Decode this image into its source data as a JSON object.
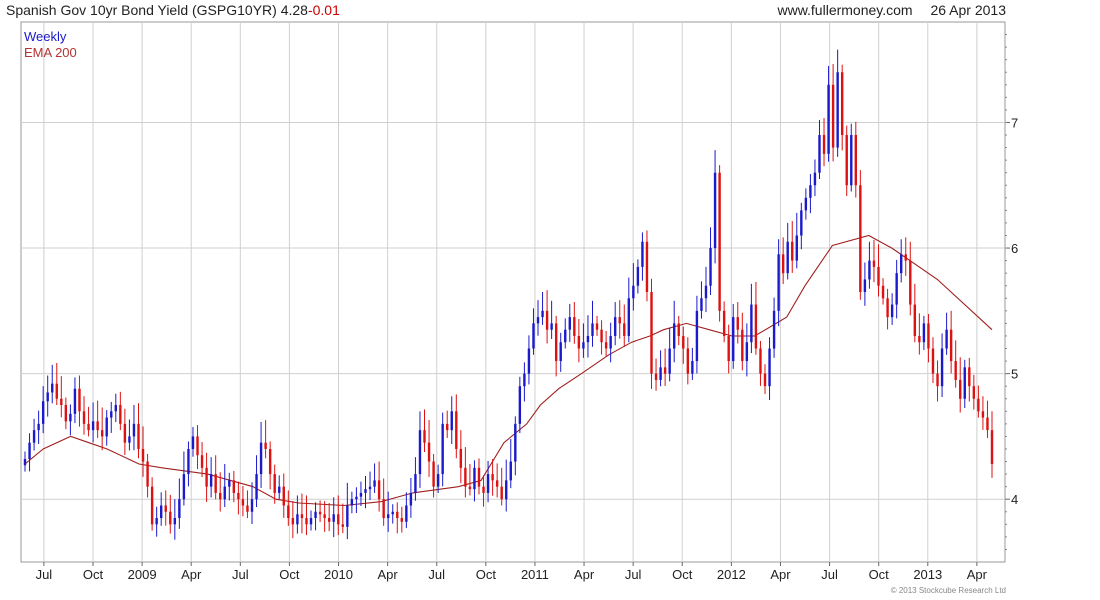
{
  "header": {
    "title": "Spanish Gov 10yr Bond Yield (GSPG10YR)",
    "last": "4.28",
    "change": "-0.01",
    "site": "www.fullermoney.com",
    "date": "26 Apr 2013"
  },
  "legend": {
    "line1": "Weekly",
    "line2": "EMA 200"
  },
  "footer": {
    "copyright": "© 2013 Stockcube Research Ltd"
  },
  "colors": {
    "up": "#1a1acc",
    "down": "#dd1111",
    "ema": "#a02020",
    "grid": "#d0d0d0"
  },
  "chart_data": {
    "type": "candlestick",
    "frequency": "weekly",
    "ylim": [
      3.5,
      7.8
    ],
    "y_ticks": [
      4,
      5,
      6,
      7
    ],
    "grid": true,
    "x_axis_ticks": [
      "Jul",
      "Oct",
      "2009",
      "Apr",
      "Jul",
      "Oct",
      "2010",
      "Apr",
      "Jul",
      "Oct",
      "2011",
      "Apr",
      "Jul",
      "Oct",
      "2012",
      "Apr",
      "Jul",
      "Oct",
      "2013",
      "Apr"
    ],
    "series": [
      {
        "name": "Weekly",
        "kind": "close",
        "values": [
          4.32,
          4.45,
          4.55,
          4.6,
          4.78,
          4.85,
          4.92,
          4.8,
          4.75,
          4.62,
          4.68,
          4.88,
          4.7,
          4.6,
          4.55,
          4.62,
          4.55,
          4.5,
          4.65,
          4.7,
          4.75,
          4.6,
          4.45,
          4.5,
          4.6,
          4.4,
          4.3,
          4.1,
          3.8,
          3.85,
          3.95,
          3.9,
          3.8,
          3.85,
          4.0,
          4.2,
          4.4,
          4.5,
          4.35,
          4.25,
          4.1,
          4.2,
          4.05,
          4.0,
          4.1,
          4.15,
          4.05,
          4.0,
          3.95,
          3.9,
          4.0,
          4.2,
          4.45,
          4.4,
          4.2,
          4.05,
          4.1,
          3.95,
          3.85,
          3.8,
          3.88,
          3.85,
          3.8,
          3.85,
          3.9,
          3.88,
          3.85,
          3.82,
          3.88,
          3.8,
          3.78,
          3.95,
          4.0,
          4.02,
          4.05,
          4.08,
          4.1,
          4.15,
          4.0,
          3.85,
          3.88,
          3.9,
          3.85,
          3.82,
          3.95,
          4.05,
          4.2,
          4.55,
          4.45,
          4.3,
          4.1,
          4.2,
          4.6,
          4.55,
          4.7,
          4.4,
          4.25,
          4.1,
          4.08,
          4.25,
          4.1,
          4.05,
          4.2,
          4.15,
          4.1,
          4.0,
          4.15,
          4.3,
          4.6,
          4.9,
          5.0,
          5.2,
          5.4,
          5.45,
          5.5,
          5.35,
          5.4,
          5.1,
          5.25,
          5.35,
          5.45,
          5.3,
          5.2,
          5.25,
          5.3,
          5.4,
          5.35,
          5.25,
          5.2,
          5.3,
          5.45,
          5.4,
          5.3,
          5.6,
          5.7,
          5.85,
          6.05,
          5.65,
          5.0,
          4.95,
          5.05,
          5.0,
          5.2,
          5.4,
          5.3,
          5.2,
          5.0,
          5.1,
          5.5,
          5.6,
          5.7,
          6.0,
          6.6,
          5.5,
          5.3,
          5.1,
          5.45,
          5.35,
          5.1,
          5.25,
          5.55,
          5.2,
          5.0,
          4.9,
          5.2,
          5.5,
          5.95,
          5.8,
          6.05,
          5.9,
          6.1,
          6.3,
          6.4,
          6.5,
          6.6,
          6.9,
          6.75,
          7.3,
          6.8,
          7.4,
          6.9,
          6.5,
          6.9,
          6.5,
          5.65,
          5.75,
          5.9,
          5.85,
          5.7,
          5.6,
          5.45,
          5.55,
          5.8,
          5.95,
          5.9,
          5.55,
          5.3,
          5.25,
          5.4,
          5.2,
          5.0,
          4.9,
          5.2,
          5.35,
          5.1,
          4.95,
          4.8,
          5.05,
          4.9,
          4.8,
          4.7,
          4.65,
          4.55,
          4.28
        ]
      },
      {
        "name": "EMA 200",
        "kind": "line",
        "x_weeks": [
          0,
          4,
          10,
          14,
          18,
          25,
          30,
          40,
          50,
          55,
          60,
          70,
          78,
          85,
          95,
          100,
          105,
          110,
          113,
          117,
          122,
          128,
          133,
          137,
          140,
          145,
          150,
          155,
          160,
          167,
          171,
          177,
          185,
          190,
          200,
          212
        ],
        "values": [
          4.28,
          4.4,
          4.5,
          4.45,
          4.4,
          4.28,
          4.25,
          4.2,
          4.1,
          4.0,
          3.97,
          3.95,
          3.98,
          4.05,
          4.1,
          4.15,
          4.45,
          4.6,
          4.75,
          4.88,
          5.0,
          5.15,
          5.25,
          5.3,
          5.35,
          5.4,
          5.35,
          5.3,
          5.3,
          5.45,
          5.7,
          6.02,
          6.1,
          6.0,
          5.75,
          5.35
        ]
      }
    ]
  }
}
